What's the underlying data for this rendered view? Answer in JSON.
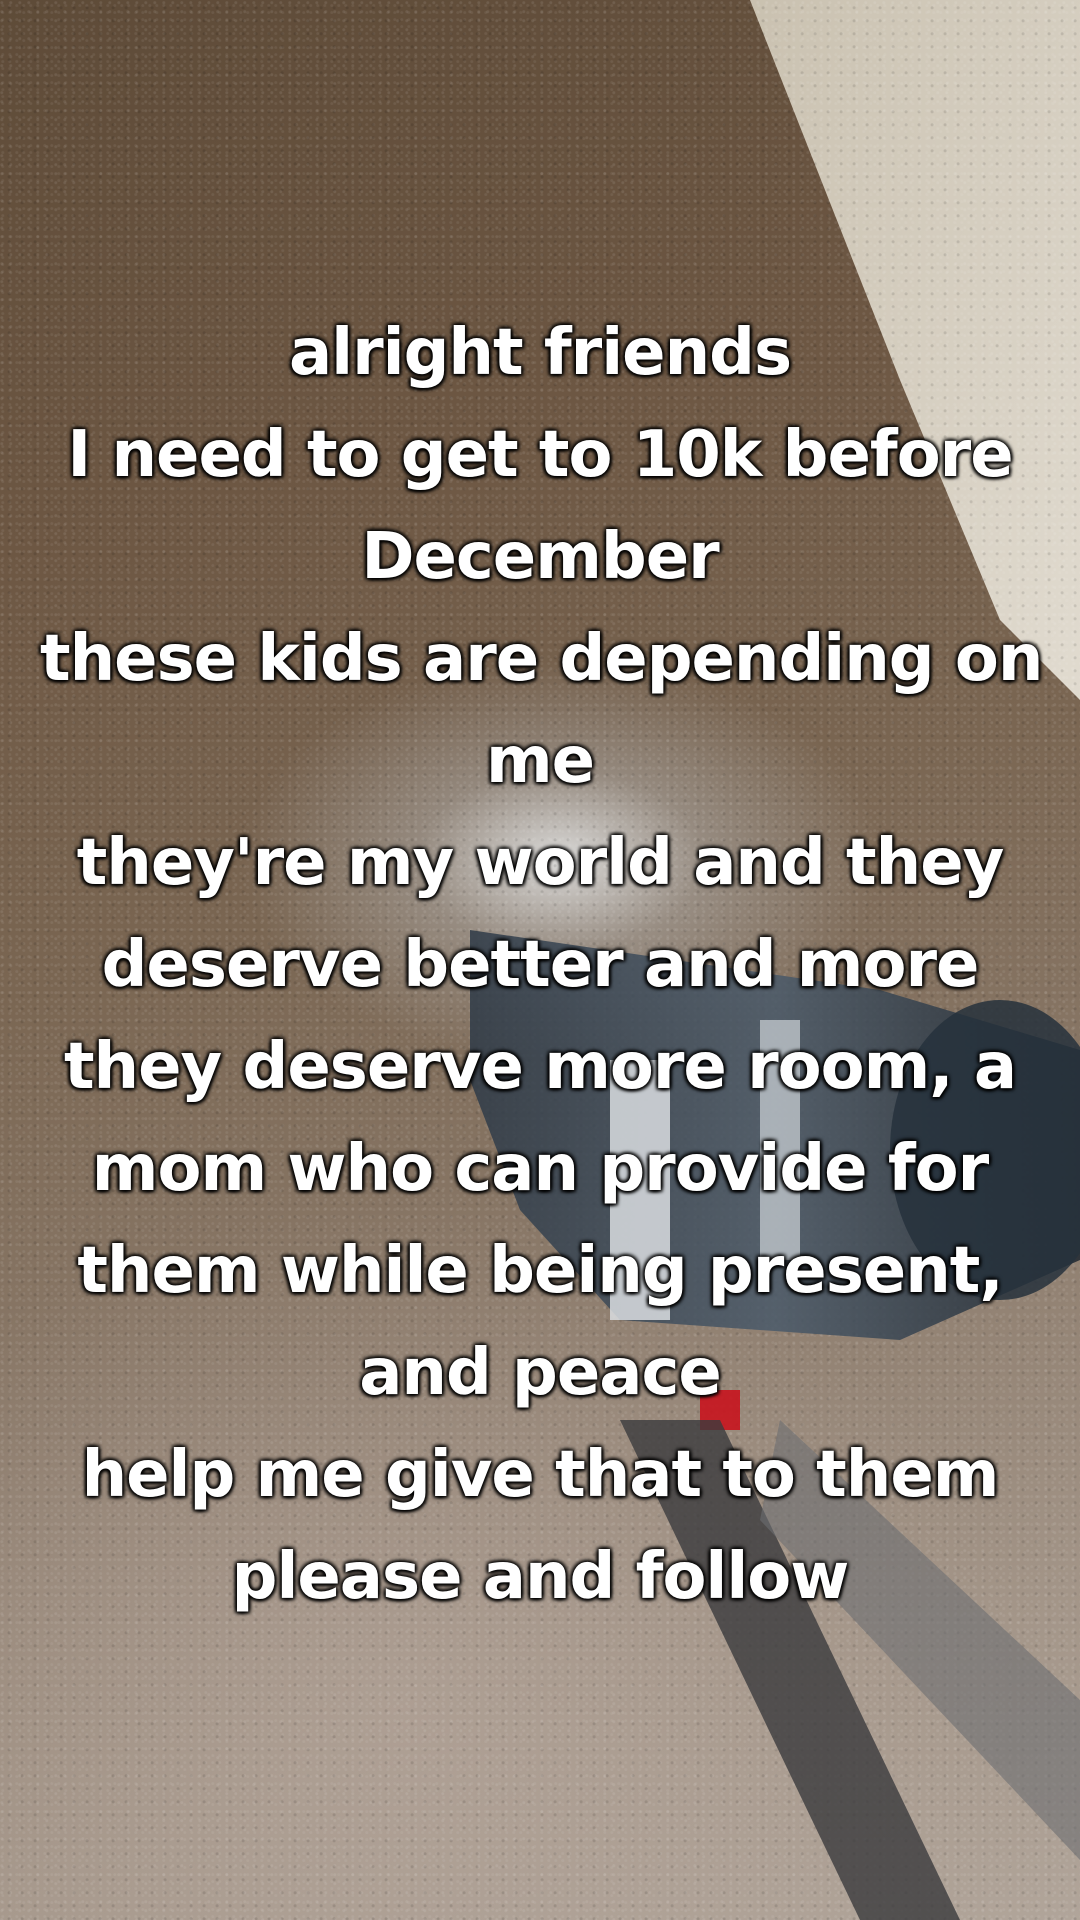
{
  "caption": {
    "lines": [
      "alright friends",
      "I need to get to 10k before",
      "December",
      "these kids are depending on",
      "me",
      "they're my world and they",
      "deserve better and more",
      "they deserve more room, a",
      "mom who can provide for",
      "them while being present,",
      "and peace",
      "help me give that to them",
      "please and follow"
    ]
  },
  "colors": {
    "text": "#ffffff",
    "text_outline": "#000000",
    "carpet": "#7a6652",
    "wall": "#d8d2c4",
    "vacuum_body": "#2a3440"
  }
}
